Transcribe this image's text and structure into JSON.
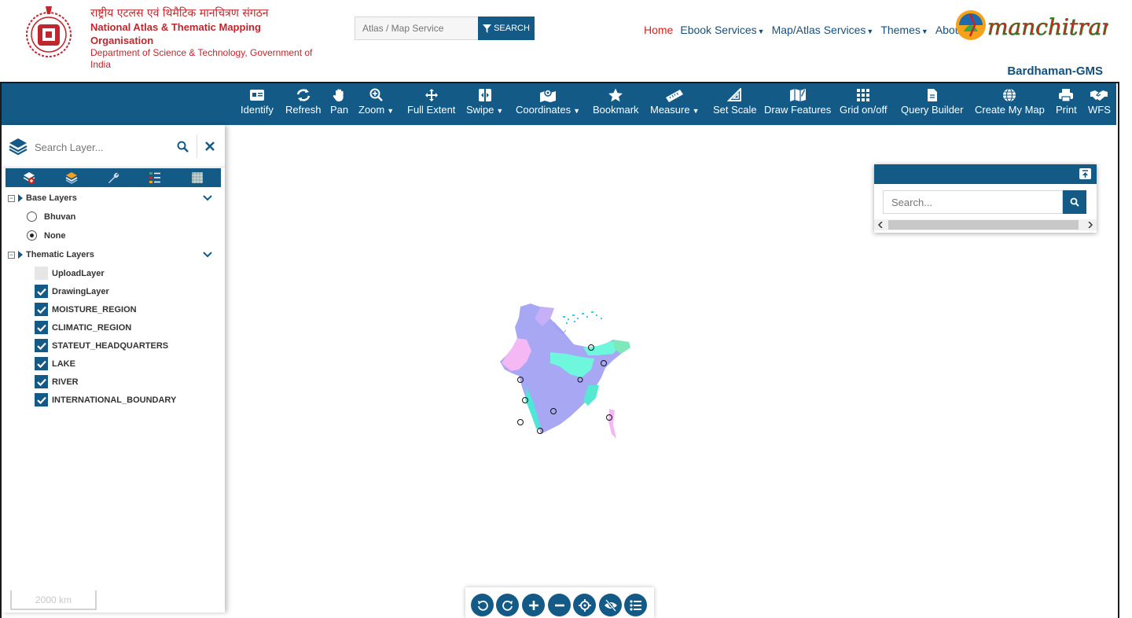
{
  "header": {
    "org_hindi": "राष्ट्रीय एटलस एवं थिमैटिक मानचित्रण संगठन",
    "org_english": "National Atlas & Thematic Mapping Organisation",
    "dept": "Department of Science & Technology, Government of India",
    "search_placeholder": "Atlas / Map Service",
    "search_button": "SEARCH",
    "nav": [
      {
        "label": "Home",
        "dropdown": false,
        "active": true
      },
      {
        "label": "Ebook Services",
        "dropdown": true
      },
      {
        "label": "Map/Atlas Services",
        "dropdown": true
      },
      {
        "label": "Themes",
        "dropdown": true
      },
      {
        "label": "About Us",
        "dropdown": false
      }
    ],
    "logo_text": "manchitran",
    "app_name": "Bardhaman-GMS"
  },
  "toolbar": {
    "tools": [
      {
        "label": "Identify",
        "icon": "id-card-icon"
      },
      {
        "label": "Refresh",
        "icon": "refresh-icon"
      },
      {
        "label": "Pan",
        "icon": "hand-icon"
      },
      {
        "label": "Zoom",
        "icon": "zoom-icon",
        "dropdown": true
      },
      {
        "label": "Full Extent",
        "icon": "move-icon"
      },
      {
        "label": "Swipe",
        "icon": "swipe-icon",
        "dropdown": true
      },
      {
        "label": "Coordinates",
        "icon": "map-pin-icon",
        "dropdown": true
      },
      {
        "label": "Bookmark",
        "icon": "star-icon"
      },
      {
        "label": "Measure",
        "icon": "ruler-icon",
        "dropdown": true
      },
      {
        "label": "Set Scale",
        "icon": "set-square-icon"
      },
      {
        "label": "Draw Features",
        "icon": "draw-map-icon"
      },
      {
        "label": "Grid on/off",
        "icon": "grid-icon"
      },
      {
        "label": "Query Builder",
        "icon": "document-icon"
      },
      {
        "label": "Create My Map",
        "icon": "globe-icon"
      },
      {
        "label": "Print",
        "icon": "printer-icon"
      },
      {
        "label": "WFS",
        "icon": "handshake-icon"
      }
    ]
  },
  "layer_panel": {
    "search_placeholder": "Search Layer...",
    "base_group": "Base Layers",
    "base_options": [
      {
        "label": "Bhuvan",
        "selected": false
      },
      {
        "label": "None",
        "selected": true
      }
    ],
    "thematic_group": "Thematic Layers",
    "thematic_layers": [
      {
        "label": "UploadLayer",
        "checked": false
      },
      {
        "label": "DrawingLayer",
        "checked": true
      },
      {
        "label": "MOISTURE_REGION",
        "checked": true
      },
      {
        "label": "CLIMATIC_REGION",
        "checked": true
      },
      {
        "label": "STATEUT_HEADQUARTERS",
        "checked": true
      },
      {
        "label": "LAKE",
        "checked": true
      },
      {
        "label": "RIVER",
        "checked": true
      },
      {
        "label": "INTERNATIONAL_BOUNDARY",
        "checked": true
      }
    ]
  },
  "scale_bar": "2000 km",
  "search_widget": {
    "placeholder": "Search..."
  },
  "colors": {
    "primary": "#145a87",
    "accent": "#d6231e"
  }
}
